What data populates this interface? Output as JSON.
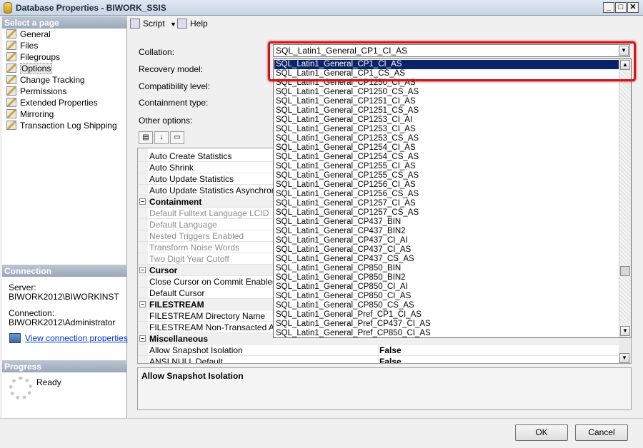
{
  "window": {
    "title": "Database Properties - BIWORK_SSIS"
  },
  "left": {
    "select_page_header": "Select a page",
    "pages": [
      "General",
      "Files",
      "Filegroups",
      "Options",
      "Change Tracking",
      "Permissions",
      "Extended Properties",
      "Mirroring",
      "Transaction Log Shipping"
    ],
    "connection_header": "Connection",
    "server_label": "Server:",
    "server_value": "BIWORK2012\\BIWORKINST",
    "connection_label": "Connection:",
    "connection_value": "BIWORK2012\\Administrator",
    "view_link": "View connection properties",
    "progress_header": "Progress",
    "progress_status": "Ready"
  },
  "toolbar": {
    "script_label": "Script",
    "help_label": "Help"
  },
  "form": {
    "collation_label": "Collation:",
    "collation_value": "SQL_Latin1_General_CP1_CI_AS",
    "recovery_label": "Recovery model:",
    "compat_label": "Compatibility level:",
    "containment_label": "Containment type:",
    "other_label": "Other options:"
  },
  "grid": {
    "rows": [
      {
        "k": "Auto Create Statistics",
        "v": ""
      },
      {
        "k": "Auto Shrink",
        "v": ""
      },
      {
        "k": "Auto Update Statistics",
        "v": ""
      },
      {
        "k": "Auto Update Statistics Asynchronously",
        "v": ""
      },
      {
        "k": "Containment",
        "v": "",
        "cat": true
      },
      {
        "k": "Default Fulltext Language LCID",
        "v": "",
        "dis": true
      },
      {
        "k": "Default Language",
        "v": "",
        "dis": true
      },
      {
        "k": "Nested Triggers Enabled",
        "v": "",
        "dis": true
      },
      {
        "k": "Transform Noise Words",
        "v": "",
        "dis": true
      },
      {
        "k": "Two Digit Year Cutoff",
        "v": "",
        "dis": true
      },
      {
        "k": "Cursor",
        "v": "",
        "cat": true
      },
      {
        "k": "Close Cursor on Commit Enabled",
        "v": ""
      },
      {
        "k": "Default Cursor",
        "v": ""
      },
      {
        "k": "FILESTREAM",
        "v": "",
        "cat": true
      },
      {
        "k": "FILESTREAM Directory Name",
        "v": ""
      },
      {
        "k": "FILESTREAM Non-Transacted Access",
        "v": ""
      },
      {
        "k": "Miscellaneous",
        "v": "",
        "cat": true
      },
      {
        "k": "Allow Snapshot Isolation",
        "v": "False"
      },
      {
        "k": "ANSI NULL Default",
        "v": "False"
      }
    ],
    "description_title": "Allow Snapshot Isolation"
  },
  "collation_options": [
    "SQL_Latin1_General_CP1_CI_AS",
    "SQL_Latin1_General_CP1_CS_AS",
    "SQL_Latin1_General_CP1250_CI_AS",
    "SQL_Latin1_General_CP1250_CS_AS",
    "SQL_Latin1_General_CP1251_CI_AS",
    "SQL_Latin1_General_CP1251_CS_AS",
    "SQL_Latin1_General_CP1253_CI_AI",
    "SQL_Latin1_General_CP1253_CI_AS",
    "SQL_Latin1_General_CP1253_CS_AS",
    "SQL_Latin1_General_CP1254_CI_AS",
    "SQL_Latin1_General_CP1254_CS_AS",
    "SQL_Latin1_General_CP1255_CI_AS",
    "SQL_Latin1_General_CP1255_CS_AS",
    "SQL_Latin1_General_CP1256_CI_AS",
    "SQL_Latin1_General_CP1256_CS_AS",
    "SQL_Latin1_General_CP1257_CI_AS",
    "SQL_Latin1_General_CP1257_CS_AS",
    "SQL_Latin1_General_CP437_BIN",
    "SQL_Latin1_General_CP437_BIN2",
    "SQL_Latin1_General_CP437_CI_AI",
    "SQL_Latin1_General_CP437_CI_AS",
    "SQL_Latin1_General_CP437_CS_AS",
    "SQL_Latin1_General_CP850_BIN",
    "SQL_Latin1_General_CP850_BIN2",
    "SQL_Latin1_General_CP850_CI_AI",
    "SQL_Latin1_General_CP850_CI_AS",
    "SQL_Latin1_General_CP850_CS_AS",
    "SQL_Latin1_General_Pref_CP1_CI_AS",
    "SQL_Latin1_General_Pref_CP437_CI_AS",
    "SQL_Latin1_General_Pref_CP850_CI_AS"
  ],
  "buttons": {
    "ok": "OK",
    "cancel": "Cancel"
  }
}
